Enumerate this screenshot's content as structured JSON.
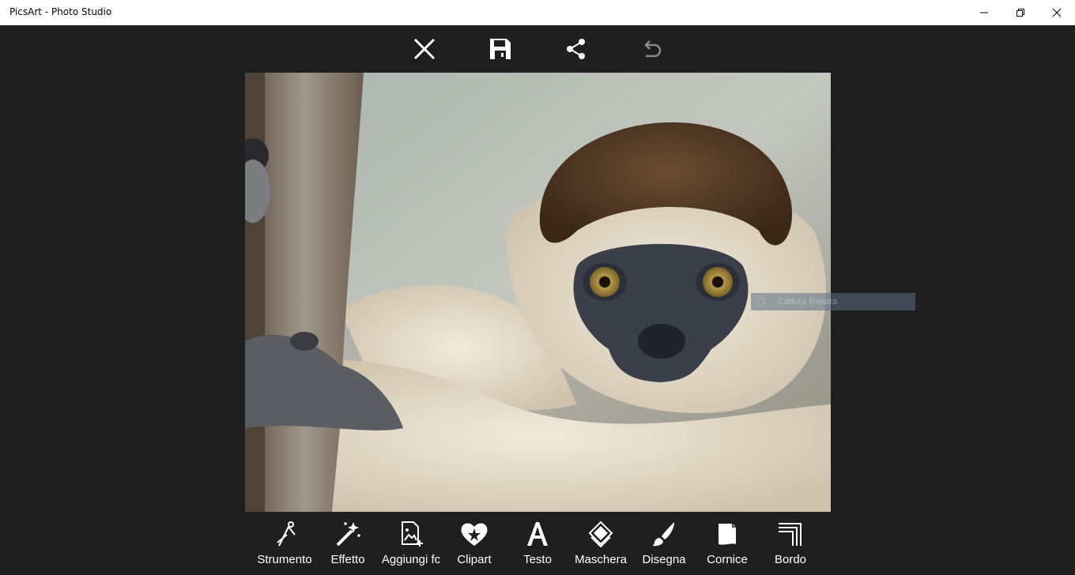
{
  "window": {
    "title": "PicsArt - Photo Studio",
    "controls": [
      "minimize-icon",
      "restore-icon",
      "close-icon"
    ]
  },
  "top_toolbar": {
    "actions": [
      {
        "name": "close",
        "icon": "close-x-icon"
      },
      {
        "name": "save",
        "icon": "floppy-disk-icon"
      },
      {
        "name": "share",
        "icon": "share-icon"
      },
      {
        "name": "undo",
        "icon": "undo-icon",
        "enabled": false
      }
    ]
  },
  "canvas": {
    "image_subject": "sifaka-lemur-photo"
  },
  "capture_tooltip": {
    "text": "Cattura finestra"
  },
  "tools": [
    {
      "label": "Strumento",
      "icon": "compass-tool-icon"
    },
    {
      "label": "Effetto",
      "icon": "magic-wand-icon"
    },
    {
      "label": "Aggiungi fc",
      "icon": "add-photo-icon"
    },
    {
      "label": "Clipart",
      "icon": "heart-star-icon"
    },
    {
      "label": "Testo",
      "icon": "text-a-icon"
    },
    {
      "label": "Maschera",
      "icon": "mask-diamond-icon"
    },
    {
      "label": "Disegna",
      "icon": "brush-icon"
    },
    {
      "label": "Cornice",
      "icon": "frame-page-icon"
    },
    {
      "label": "Bordo",
      "icon": "border-corner-icon"
    }
  ],
  "colors": {
    "background": "#1f1f1f",
    "titlebar": "#ffffff",
    "icon": "#ffffff",
    "disabled_icon": "#8a8a8a"
  }
}
